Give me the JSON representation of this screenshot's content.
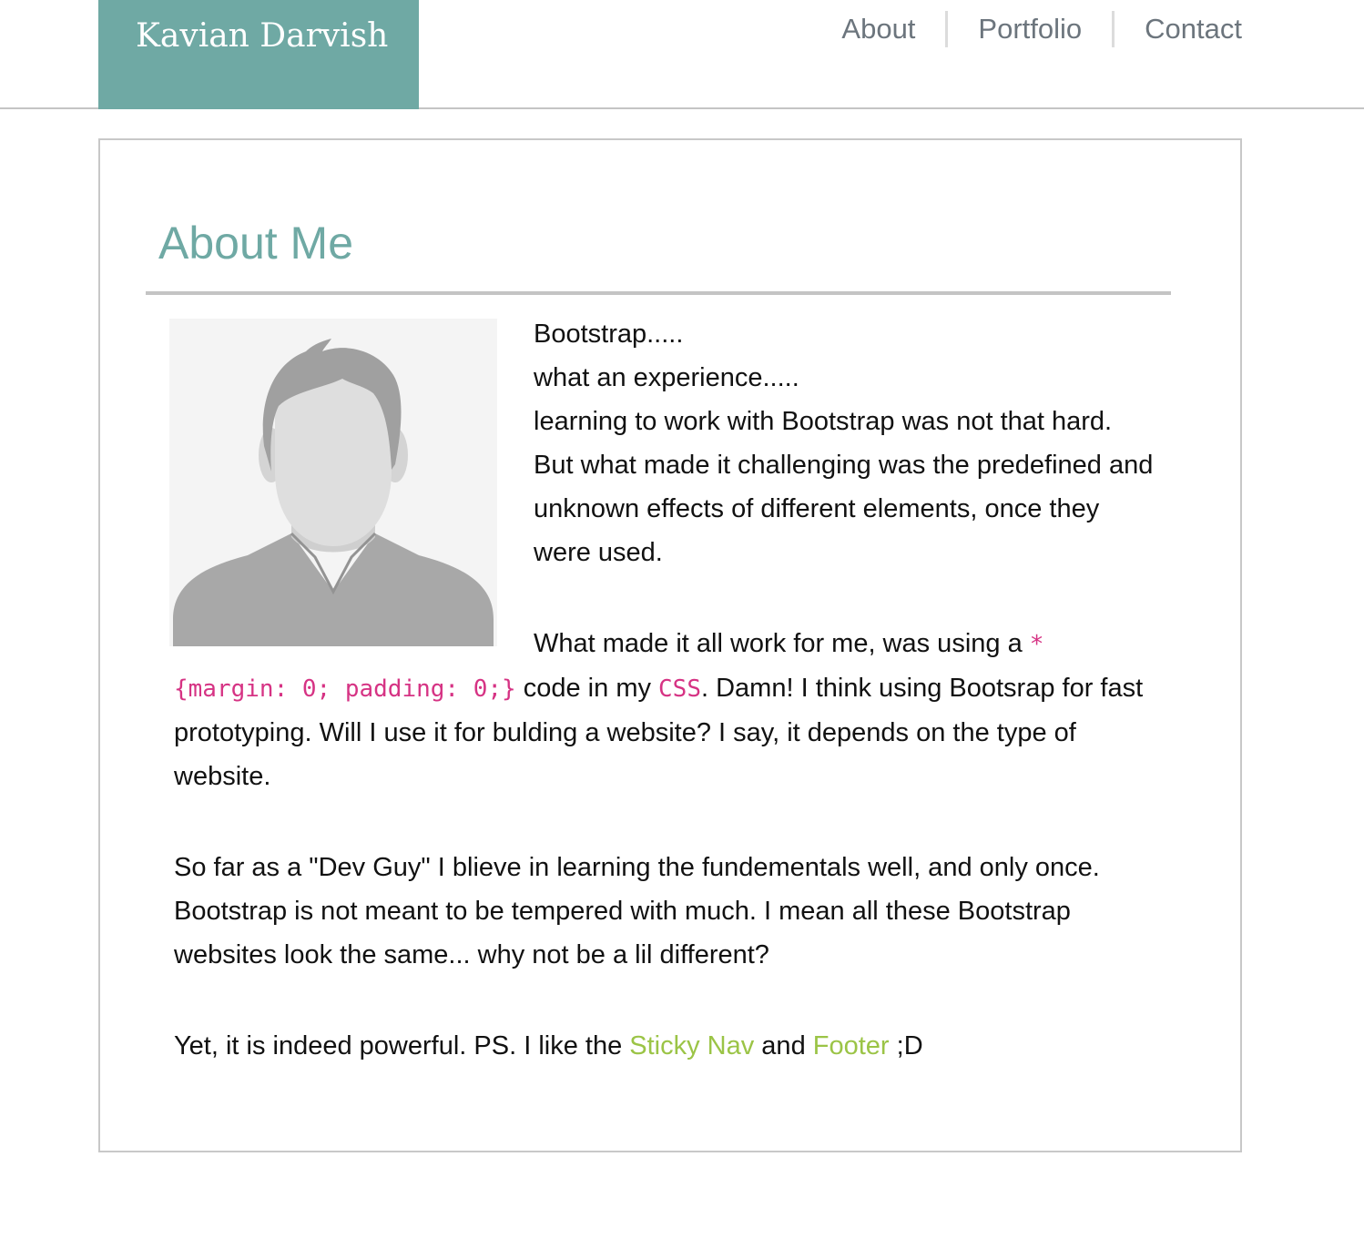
{
  "header": {
    "brand": "Kavian Darvish",
    "nav": {
      "about": "About",
      "portfolio": "Portfolio",
      "contact": "Contact"
    }
  },
  "about": {
    "title": "About Me",
    "p1": {
      "line1": "Bootstrap.....",
      "line2": "what an experience.....",
      "line3": "learning to work with Bootstrap was not that hard. But what made it challenging was the predefined and unknown effects of different elements, once they were used."
    },
    "p2": {
      "text_a": "What made it all work for me, was using a ",
      "code_snippet": "* {margin: 0; padding: 0;}",
      "text_b": " code in my ",
      "code_css": "CSS",
      "text_c": ". Damn! I think using Bootsrap for fast prototyping. Will I use it for bulding a website? I say, it depends on the type of website."
    },
    "p3": "So far as a \"Dev Guy\" I blieve in learning the fundementals well, and only once. Bootstrap is not meant to be tempered with much. I mean all these Bootstrap websites look the same... why not be a lil different?",
    "p4": {
      "text_a": "Yet, it is indeed powerful. PS. I like the ",
      "link_sticky_nav": "Sticky Nav",
      "text_b": " and ",
      "link_footer": "Footer",
      "text_c": " ;D"
    }
  },
  "colors": {
    "accent": "#6fa9a4",
    "nav_text": "#6c757d",
    "code": "#d63384",
    "link": "#9bc446",
    "border": "#c4c4c4"
  },
  "icons": {
    "avatar": "person-placeholder-icon"
  }
}
